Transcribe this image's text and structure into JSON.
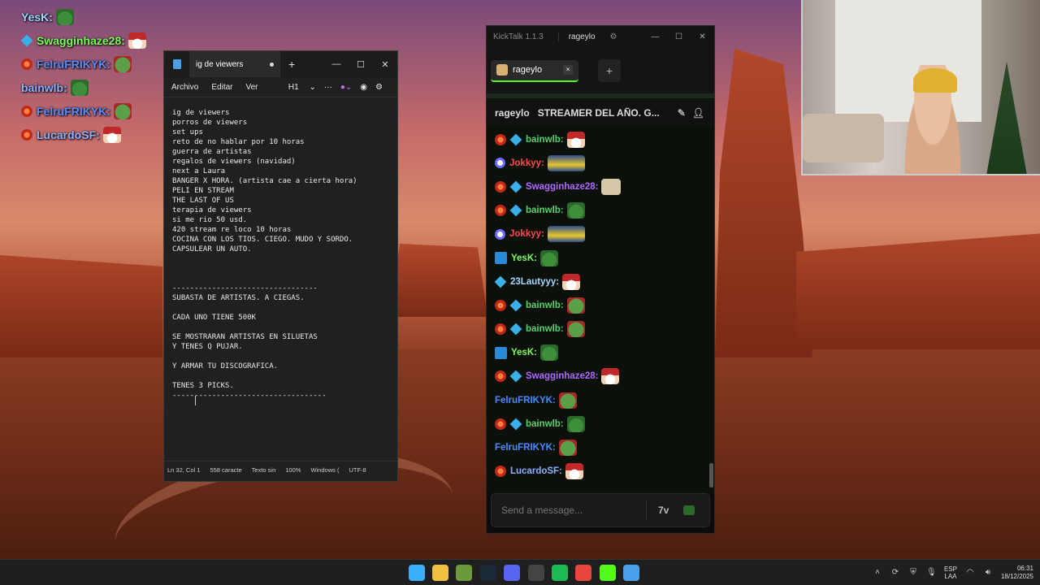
{
  "overlay": {
    "rows": [
      {
        "name": "YesK:",
        "color": "#9fd8ff"
      },
      {
        "name": "Swagginhaze28:",
        "color": "#7cff5a"
      },
      {
        "name": "FelruFRIKYK:",
        "color": "#5a8cff"
      },
      {
        "name": "bainwlb:",
        "color": "#8fb0ff"
      },
      {
        "name": "FelruFRIKYK:",
        "color": "#5a8cff"
      },
      {
        "name": "LucardoSF:",
        "color": "#8fb0ff"
      }
    ]
  },
  "notepad": {
    "tab_title": "ig de viewers",
    "menu": [
      "Archivo",
      "Editar",
      "Ver"
    ],
    "heading_select": "H1",
    "more": "···",
    "content": "ig de viewers\nporros de viewers\nset ups\nreto de no hablar por 10 horas\nguerra de artistas\nregalos de viewers (navidad)\nnext a Laura\nBANGER X HORA. (artista cae a cierta hora)\nPELI EN STREAM\nTHE LAST OF US\nterapia de viewers\nsi me rio 50 usd.\n420 stream re loco 10 horas\nCOCINA CON LOS TIOS. CIEGO. MUDO Y SORDO.\nCAPSULEAR UN AUTO.\n\n\n\n---------------------------------\nSUBASTA DE ARTISTAS. A CIEGAS.\n\nCADA UNO TIENE 500K\n\nSE MOSTRARAN ARTISTAS EN SILUETAS\nY TENES Q PUJAR.\n\nY ARMAR TU DISCOGRAFICA.\n\nTENES 3 PICKS.\n-----------------------------------",
    "status": {
      "position": "Ln 32, Col 1",
      "chars": "558 caracte",
      "format": "Texto sin",
      "zoom": "100%",
      "line_endings": "Windows (",
      "encoding": "UTF-8"
    }
  },
  "kicktalk": {
    "app_title": "KickTalk 1.1.3",
    "user": "rageylo",
    "tab_label": "rageylo",
    "tab_close": "×",
    "add_tab": "+",
    "channel": "rageylo",
    "stream_title": "STREAMER DEL AÑO. G...",
    "input_placeholder": "Send a message...",
    "seventv_label": "7v",
    "messages": [
      {
        "badges": [
          "red",
          "cube"
        ],
        "name": "bainwlb:",
        "color": "#5ad06a",
        "emote": "santa"
      },
      {
        "badges": [
          "ring"
        ],
        "name": "Jokkyy:",
        "color": "#ff4a4a",
        "emote": "jok"
      },
      {
        "badges": [
          "red",
          "cube"
        ],
        "name": "Swagginhaze28:",
        "color": "#b06aff",
        "emote": "cat"
      },
      {
        "badges": [
          "red",
          "cube"
        ],
        "name": "bainwlb:",
        "color": "#5ad06a",
        "emote": "frog"
      },
      {
        "badges": [
          "ring"
        ],
        "name": "Jokkyy:",
        "color": "#ff4a4a",
        "emote": "jok"
      },
      {
        "badges": [
          "hammer"
        ],
        "name": "YesK:",
        "color": "#7cff5a",
        "emote": "frog"
      },
      {
        "badges": [
          "cube"
        ],
        "name": "23Lautyyy:",
        "color": "#9fd8ff",
        "emote": "santa"
      },
      {
        "badges": [
          "red",
          "cube"
        ],
        "name": "bainwlb:",
        "color": "#5ad06a",
        "emote": "pepe"
      },
      {
        "badges": [
          "red",
          "cube"
        ],
        "name": "bainwlb:",
        "color": "#5ad06a",
        "emote": "pepe"
      },
      {
        "badges": [
          "hammer"
        ],
        "name": "YesK:",
        "color": "#7cff5a",
        "emote": "frog"
      },
      {
        "badges": [
          "red",
          "cube"
        ],
        "name": "Swagginhaze28:",
        "color": "#b06aff",
        "emote": "santa"
      },
      {
        "badges": [],
        "name": "FelruFRIKYK:",
        "color": "#4a8cff",
        "emote": "pepe"
      },
      {
        "badges": [
          "red",
          "cube"
        ],
        "name": "bainwlb:",
        "color": "#5ad06a",
        "emote": "frog"
      },
      {
        "badges": [],
        "name": "FelruFRIKYK:",
        "color": "#4a8cff",
        "emote": "pepe"
      },
      {
        "badges": [
          "red"
        ],
        "name": "LucardoSF:",
        "color": "#8fb0ff",
        "emote": "santa"
      }
    ]
  },
  "taskbar": {
    "apps": [
      {
        "name": "windows-start-icon",
        "color": "#3ab0ff"
      },
      {
        "name": "file-explorer-icon",
        "color": "#f0c040"
      },
      {
        "name": "minecraft-icon",
        "color": "#6a9a3a"
      },
      {
        "name": "steam-icon",
        "color": "#1b2838"
      },
      {
        "name": "discord-icon",
        "color": "#5865f2"
      },
      {
        "name": "obs-icon",
        "color": "#444444"
      },
      {
        "name": "spotify-icon",
        "color": "#1db954"
      },
      {
        "name": "chrome-icon",
        "color": "#e8453c"
      },
      {
        "name": "kick-icon",
        "color": "#53fc18"
      },
      {
        "name": "notepad-icon",
        "color": "#4aa0e8"
      }
    ],
    "lang_top": "ESP",
    "lang_bottom": "LAA",
    "time": "06:31",
    "date": "18/12/2025"
  }
}
